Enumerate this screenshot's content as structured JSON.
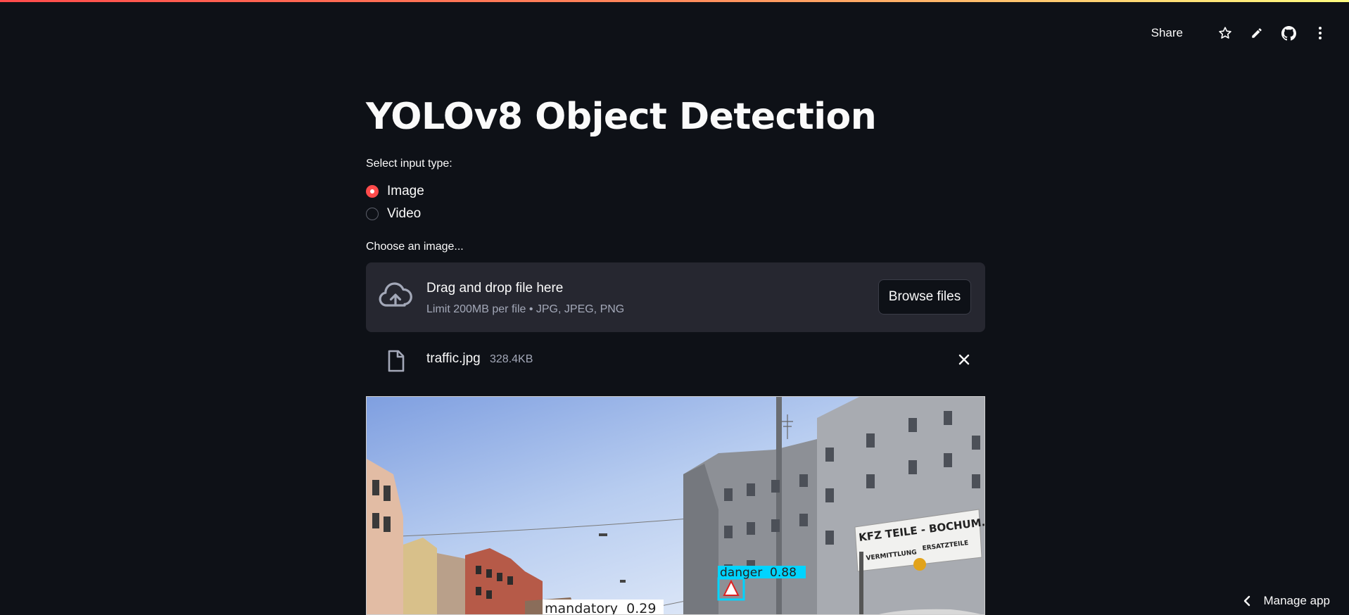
{
  "header": {
    "share_label": "Share"
  },
  "title": "YOLOv8 Object Detection",
  "input_type": {
    "label": "Select input type:",
    "options": [
      "Image",
      "Video"
    ],
    "selected": "Image"
  },
  "uploader": {
    "label": "Choose an image...",
    "drag_text": "Drag and drop file here",
    "limit_text": "Limit 200MB per file • JPG, JPEG, PNG",
    "browse_label": "Browse files"
  },
  "uploaded_file": {
    "name": "traffic.jpg",
    "size": "328.4KB"
  },
  "detections": [
    {
      "label": "danger",
      "score": "0.88",
      "text": "danger  0.88",
      "color": "#00d4ff"
    },
    {
      "label": "mandatory",
      "score": "0.29",
      "text": "mandatory  0.29",
      "color": "#ffffff"
    }
  ],
  "sign": {
    "line1": "KFZ TEILE - BOCHUM.DE",
    "line2": "ERSATZTEILE",
    "line3": "VERMITTLUNG"
  },
  "footer": {
    "manage_app_label": "Manage app"
  },
  "colors": {
    "background": "#0e1117",
    "accent": "#ff4b4b",
    "surface": "#262730"
  }
}
